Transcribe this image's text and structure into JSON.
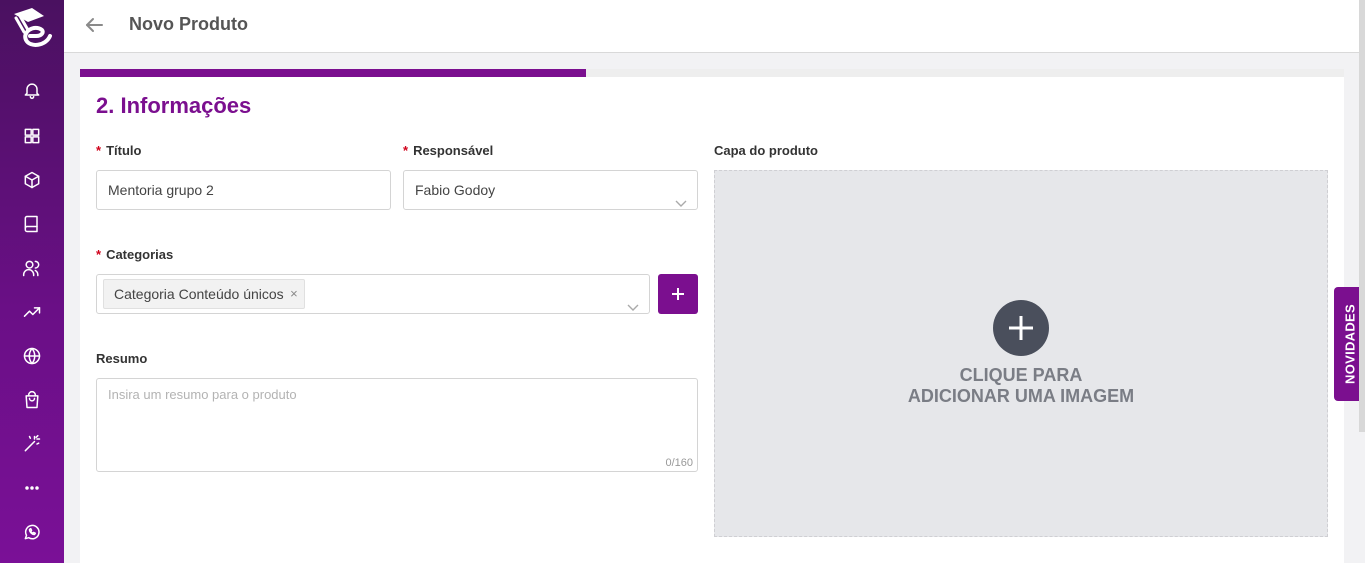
{
  "header": {
    "title": "Novo Produto"
  },
  "progress": {
    "fraction": 0.4
  },
  "section": {
    "title": "2. Informações"
  },
  "form": {
    "title_label": "Título",
    "title_value": "Mentoria grupo 2",
    "responsible_label": "Responsável",
    "responsible_value": "Fabio Godoy",
    "categories_label": "Categorias",
    "categories_selected": [
      "Categoria Conteúdo únicos"
    ],
    "summary_label": "Resumo",
    "summary_placeholder": "Insira um resumo para o produto",
    "summary_counter": "0/160",
    "cover_label": "Capa do produto",
    "cover_text_line1": "CLIQUE PARA",
    "cover_text_line2": "ADICIONAR UMA IMAGEM",
    "required_mark": "*"
  },
  "novidades": {
    "label": "NOVIDADES"
  },
  "sidebar": {
    "items": [
      {
        "icon": "bell-icon"
      },
      {
        "icon": "grid-icon"
      },
      {
        "icon": "box-icon"
      },
      {
        "icon": "book-icon"
      },
      {
        "icon": "users-icon"
      },
      {
        "icon": "trending-up-icon"
      },
      {
        "icon": "globe-icon"
      },
      {
        "icon": "shopping-bag-icon"
      },
      {
        "icon": "magic-wand-icon"
      },
      {
        "icon": "more-icon"
      },
      {
        "icon": "whatsapp-icon"
      }
    ]
  },
  "colors": {
    "accent": "#7b0f8f",
    "sidebar": "#5a0f75",
    "required": "#d0021b"
  }
}
